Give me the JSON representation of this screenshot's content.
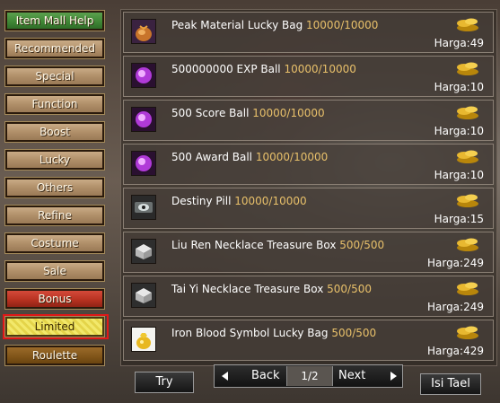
{
  "sidebar": {
    "items": [
      {
        "label": "Item Mall Help"
      },
      {
        "label": "Recommended"
      },
      {
        "label": "Special"
      },
      {
        "label": "Function"
      },
      {
        "label": "Boost"
      },
      {
        "label": "Lucky"
      },
      {
        "label": "Others"
      },
      {
        "label": "Refine"
      },
      {
        "label": "Costume"
      },
      {
        "label": "Sale"
      },
      {
        "label": "Bonus"
      },
      {
        "label": "Limited"
      },
      {
        "label": "Roulette"
      }
    ]
  },
  "items": [
    {
      "name": "Peak Material Lucky Bag",
      "qty": "10000/10000",
      "price": "Harga:49",
      "icon": "lucky-bag-icon"
    },
    {
      "name": "500000000 EXP Ball",
      "qty": "10000/10000",
      "price": "Harga:10",
      "icon": "exp-ball-icon"
    },
    {
      "name": "500 Score Ball",
      "qty": "10000/10000",
      "price": "Harga:10",
      "icon": "score-ball-icon"
    },
    {
      "name": "500 Award Ball",
      "qty": "10000/10000",
      "price": "Harga:10",
      "icon": "award-ball-icon"
    },
    {
      "name": "Destiny Pill",
      "qty": "10000/10000",
      "price": "Harga:15",
      "icon": "destiny-pill-icon"
    },
    {
      "name": "Liu Ren Necklace Treasure Box",
      "qty": "500/500",
      "price": "Harga:249",
      "icon": "treasure-box-icon"
    },
    {
      "name": "Tai Yi Necklace Treasure Box",
      "qty": "500/500",
      "price": "Harga:249",
      "icon": "treasure-box-icon"
    },
    {
      "name": "Iron Blood Symbol Lucky Bag",
      "qty": "500/500",
      "price": "Harga:429",
      "icon": "gold-bag-icon"
    }
  ],
  "controls": {
    "try_label": "Try",
    "back_label": "Back",
    "page": "1/2",
    "next_label": "Next",
    "topup_label": "Isi Tael"
  },
  "colors": {
    "quantity": "#e8c06a",
    "limited_highlight": "#e01818"
  }
}
